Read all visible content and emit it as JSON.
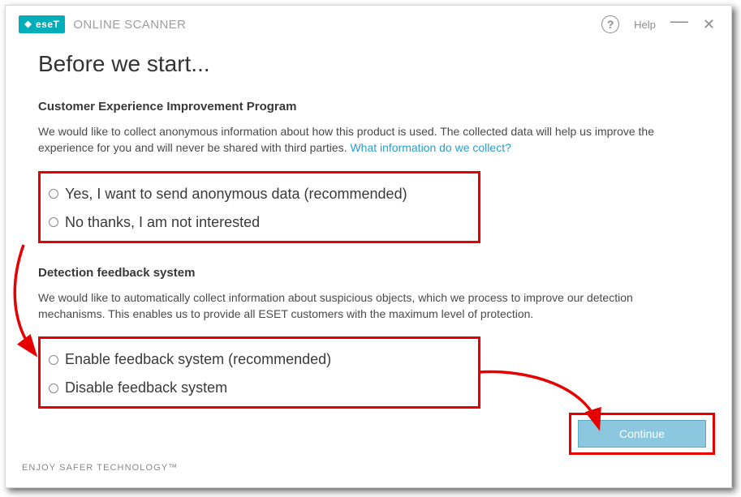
{
  "header": {
    "logo_text": "eseT",
    "product_name": "ONLINE SCANNER",
    "help_label": "Help"
  },
  "page_title": "Before we start...",
  "section1": {
    "heading": "Customer Experience Improvement Program",
    "description": "We would like to collect anonymous information about how this product is used. The collected data will help us improve the experience for you and will never be shared with third parties. ",
    "info_link": "What information do we collect?",
    "option_yes": "Yes, I want to send anonymous data (recommended)",
    "option_no": "No thanks, I am not interested"
  },
  "section2": {
    "heading": "Detection feedback system",
    "description": "We would like to automatically collect information about suspicious objects, which we process to improve our detection mechanisms. This enables us to provide all ESET customers with the maximum level of protection.",
    "option_enable": "Enable feedback system (recommended)",
    "option_disable": "Disable feedback system"
  },
  "buttons": {
    "continue": "Continue"
  },
  "footer": {
    "tagline": "ENJOY SAFER TECHNOLOGY™"
  }
}
